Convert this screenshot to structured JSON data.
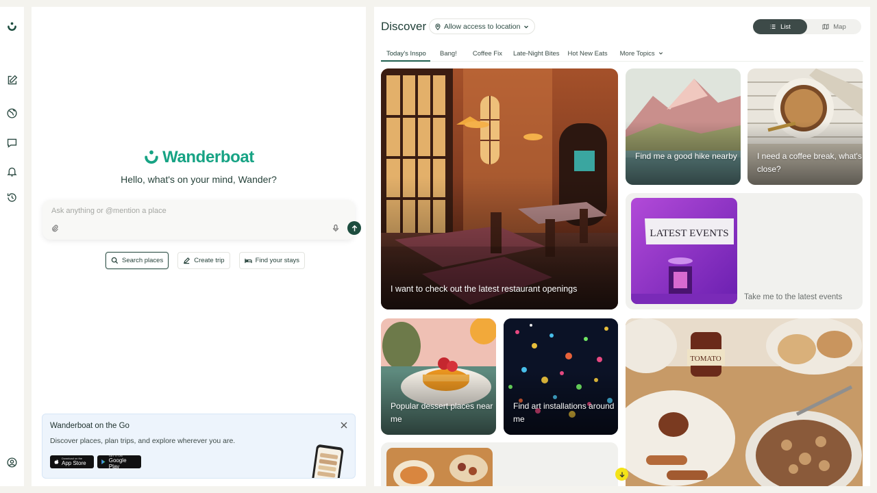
{
  "rail": {
    "items": [
      {
        "name": "logo-icon"
      },
      {
        "name": "new-chat-icon"
      },
      {
        "name": "explore-globe-icon"
      },
      {
        "name": "messages-icon"
      },
      {
        "name": "notifications-bell-icon"
      },
      {
        "name": "history-icon"
      },
      {
        "name": "account-icon"
      }
    ]
  },
  "chat": {
    "brand": "Wanderboat",
    "greeting_prefix": "Hello, what's on your mind, ",
    "greeting_name": "Wander?",
    "input_placeholder": "Ask anything or @mention a place",
    "input_value": "",
    "chips": [
      {
        "label": "Search places",
        "icon": "search-icon"
      },
      {
        "label": "Create trip",
        "icon": "pencil-icon"
      },
      {
        "label": "Find your stays",
        "icon": "bed-icon"
      }
    ],
    "promo": {
      "title": "Wanderboat on the Go",
      "description": "Discover places, plan trips, and explore wherever you are.",
      "app_store_small": "Download on the",
      "app_store": "App Store",
      "google_play_small": "GET IT ON",
      "google_play": "Google Play"
    }
  },
  "discover": {
    "title": "Discover",
    "location_label": "Allow access to location",
    "view_toggle": {
      "list": "List",
      "map": "Map",
      "selected": "List"
    },
    "tabs": [
      "Today's Inspo",
      "Bang!",
      "Coffee Fix",
      "Late-Night Bites",
      "Hot New Eats"
    ],
    "more_topics": "More Topics",
    "cards": [
      {
        "caption": "I want to check out the latest restaurant openings"
      },
      {
        "caption": "Find me a good hike nearby"
      },
      {
        "caption": "I need a coffee break, what's close?"
      },
      {
        "caption": "Take me to the latest events",
        "poster_text": "LATEST EVENTS"
      },
      {
        "caption": "Popular dessert places near me"
      },
      {
        "caption": "Find art installations around me"
      },
      {
        "caption": ""
      },
      {
        "caption": "",
        "jar_label": "TOMATO"
      }
    ]
  },
  "colors": {
    "brand_green": "#17a384",
    "dark_green": "#1d4d3f",
    "toggle_active": "#3d4a48",
    "scroll_yellow": "#f4e318"
  }
}
